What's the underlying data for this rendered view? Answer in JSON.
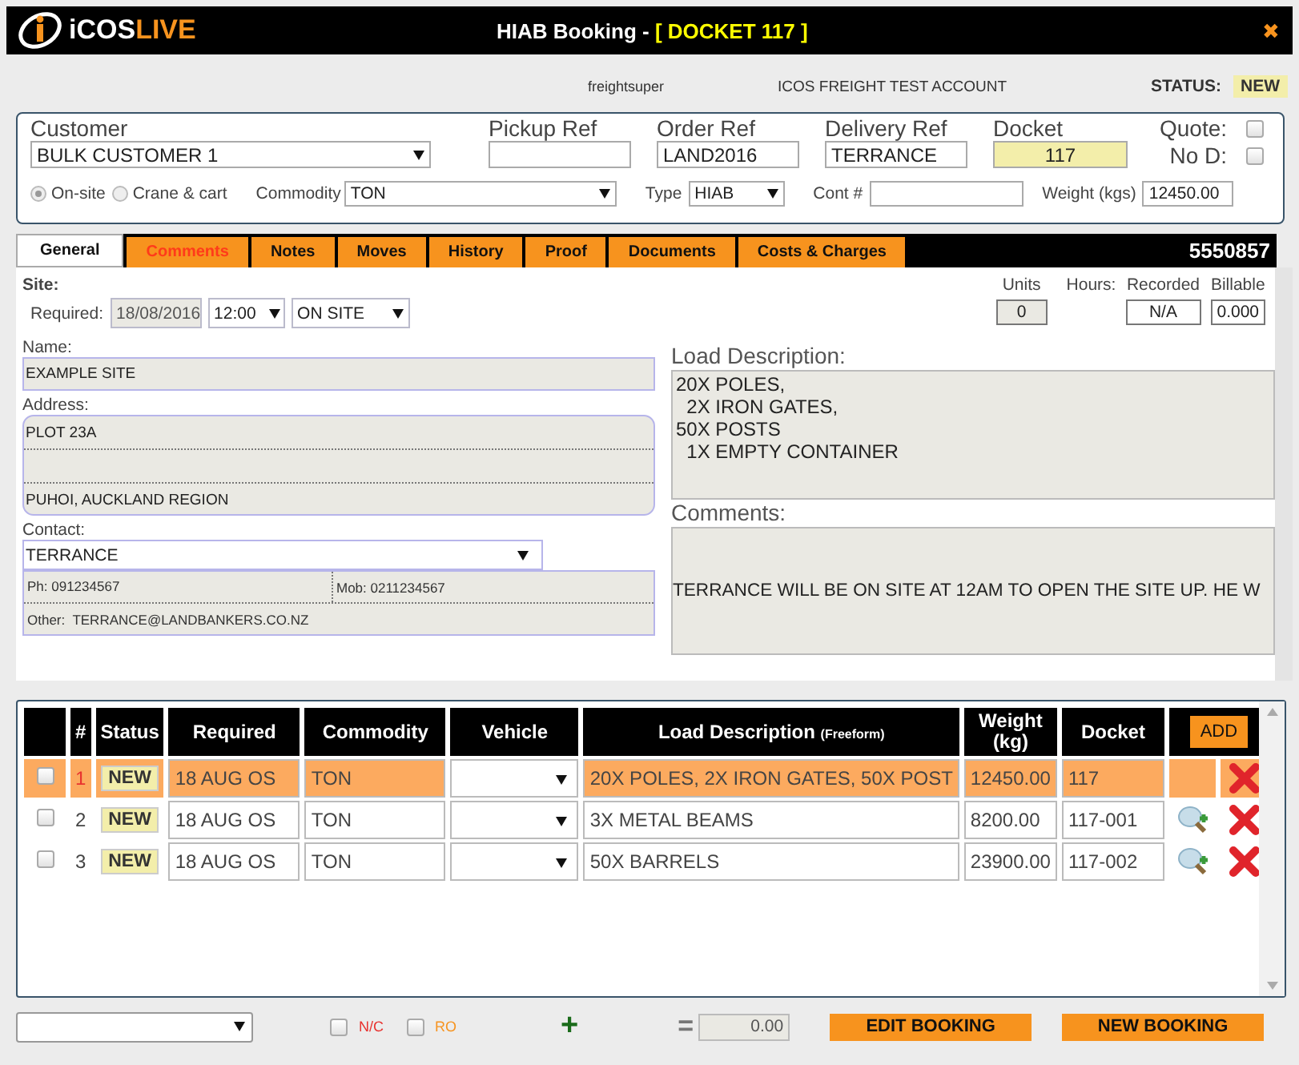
{
  "header": {
    "logo_1": "iCOS",
    "logo_2": "LIVE",
    "title": "HIAB Booking - ",
    "docket": "[ DOCKET 117 ]",
    "close": "✖"
  },
  "info": {
    "user": "freightsuper",
    "account": "ICOS FREIGHT TEST ACCOUNT",
    "status_label": "STATUS:",
    "status": "NEW"
  },
  "booking": {
    "customer": {
      "label": "Customer",
      "value": "BULK CUSTOMER 1"
    },
    "refs": [
      {
        "label": "Pickup Ref"
      },
      {
        "label": "Order Ref",
        "value": "LAND2016"
      },
      {
        "label": "Delivery Ref",
        "value": "TERRANCE"
      }
    ],
    "docket": {
      "label": "Docket",
      "value": "117"
    },
    "flags": [
      {
        "label": "Quote:",
        "checked": false
      },
      {
        "label": "No D:",
        "checked": false
      }
    ],
    "modes": [
      {
        "label": "On-site",
        "selected": true
      },
      {
        "label": "Crane & cart",
        "selected": false
      }
    ],
    "commodity": {
      "label": "Commodity",
      "value": "TON"
    },
    "type": {
      "label": "Type",
      "value": "HIAB"
    },
    "cont": {
      "label": "Cont #"
    },
    "weight": {
      "label": "Weight (kgs)",
      "value": "12450.00"
    }
  },
  "tabs": [
    {
      "label": "General",
      "selected": true,
      "flagged": false
    },
    {
      "label": "Comments",
      "selected": false,
      "flagged": true
    },
    {
      "label": "Notes",
      "selected": false,
      "flagged": false
    },
    {
      "label": "Moves",
      "selected": false,
      "flagged": false
    },
    {
      "label": "History",
      "selected": false,
      "flagged": false
    },
    {
      "label": "Proof",
      "selected": false,
      "flagged": false
    },
    {
      "label": "Documents",
      "selected": false,
      "flagged": false
    },
    {
      "label": "Costs & Charges",
      "selected": false,
      "flagged": false
    }
  ],
  "tab_number": "5550857",
  "general": {
    "site_label": "Site:",
    "required_label": "Required:",
    "date": "18/08/2016",
    "time": "12:00",
    "site_status": "ON SITE",
    "units_label": "Units",
    "units": "0",
    "hours_label": "Hours:",
    "recorded_label": "Recorded",
    "recorded": "N/A",
    "billable_label": "Billable",
    "billable": "0.000",
    "name_label": "Name:",
    "name": "EXAMPLE SITE",
    "address_label": "Address:",
    "address": [
      "PLOT 23A",
      "PUHOI, AUCKLAND REGION"
    ],
    "contact_label": "Contact:",
    "contact": "TERRANCE",
    "ph_label": "Ph:",
    "ph": "091234567",
    "mob_label": "Mob:",
    "mob": "0211234567",
    "other_label": "Other:",
    "other": "TERRANCE@LANDBANKERS.CO.NZ",
    "load_label": "Load Description:",
    "load": [
      "20X POLES,",
      "  2X IRON GATES,",
      "50X POSTS",
      "  1X EMPTY CONTAINER"
    ],
    "comments_label": "Comments:",
    "comments": "TERRANCE WILL BE ON SITE AT 12AM TO OPEN THE SITE UP. HE W"
  },
  "table": {
    "columns": [
      "#",
      "Status",
      "Required",
      "Commodity",
      "Vehicle",
      "Load Description",
      "(Freeform)",
      "Weight (kg)",
      "Docket"
    ],
    "add": "ADD",
    "rows": [
      {
        "selected": true,
        "checked": false,
        "num": "1",
        "status": "NEW",
        "required": "18 AUG  OS",
        "commodity": "TON",
        "load": "20X POLES, 2X IRON GATES, 50X POST",
        "weight": "12450.00",
        "docket": "117",
        "preview": false
      },
      {
        "selected": false,
        "checked": false,
        "num": "2",
        "status": "NEW",
        "required": "18 AUG  OS",
        "commodity": "TON",
        "load": "3X METAL BEAMS",
        "weight": "8200.00",
        "docket": "117-001",
        "preview": true
      },
      {
        "selected": false,
        "checked": false,
        "num": "3",
        "status": "NEW",
        "required": "18 AUG  OS",
        "commodity": "TON",
        "load": "50X BARRELS",
        "weight": "23900.00",
        "docket": "117-002",
        "preview": true
      }
    ]
  },
  "footer": {
    "checks": [
      {
        "label": "N/C",
        "checked": false,
        "color": "#e8322f"
      },
      {
        "label": "RO",
        "checked": false,
        "color": "#f7931e"
      }
    ],
    "plus": "+",
    "equals": "=",
    "total": "0.00",
    "buttons": [
      "EDIT BOOKING",
      "NEW BOOKING"
    ]
  }
}
